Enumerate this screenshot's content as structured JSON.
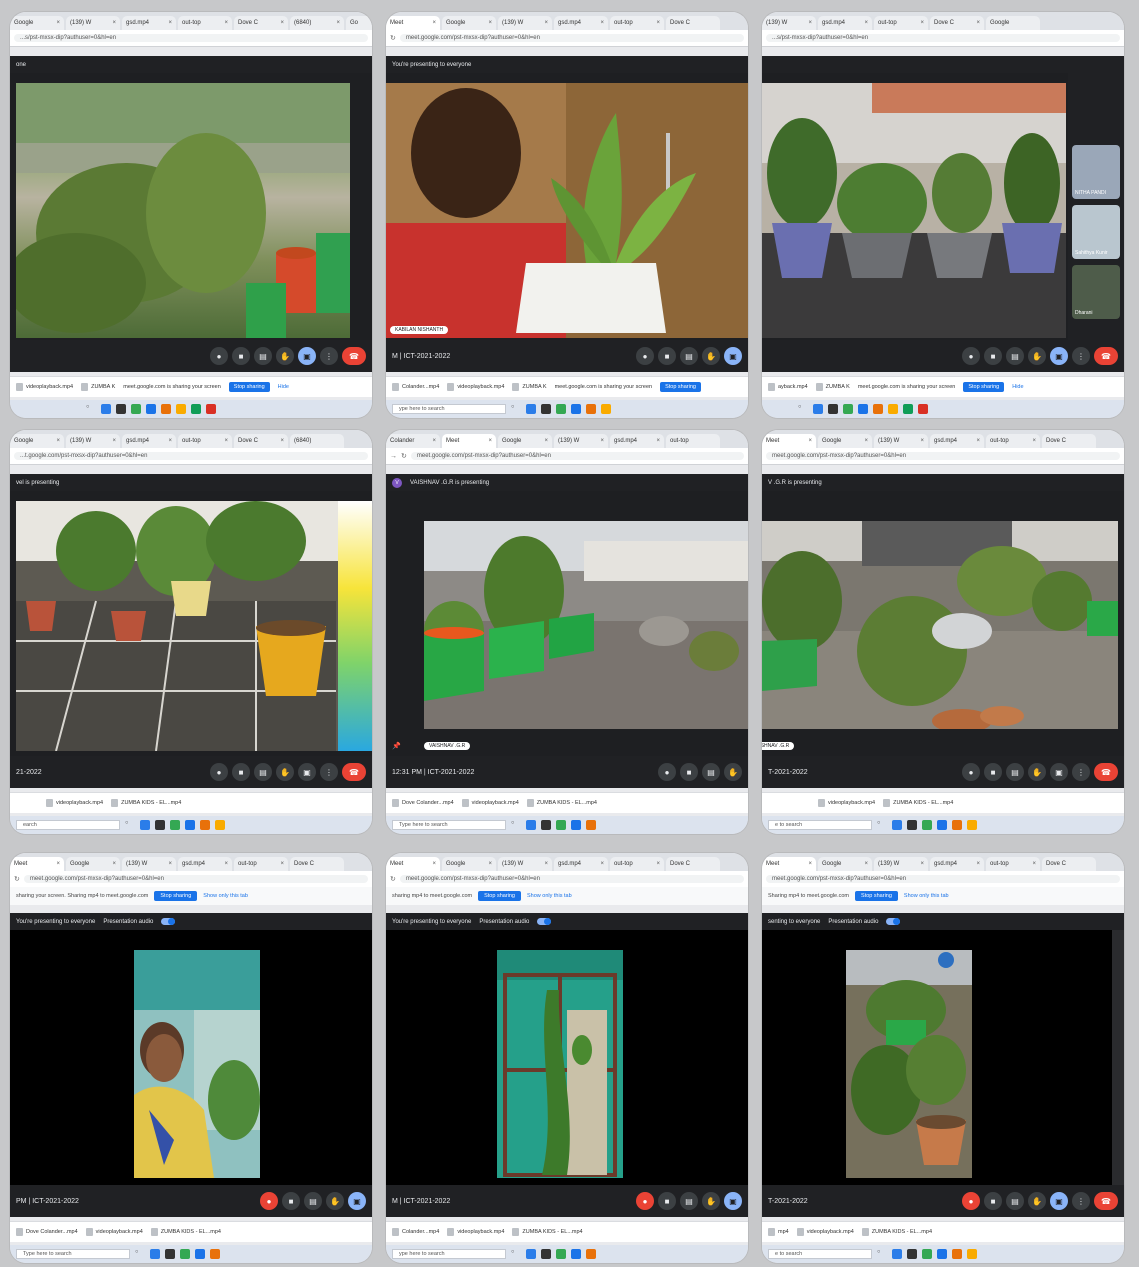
{
  "tiles": [
    {
      "tabs": [
        "Google",
        "(139) W",
        "gsd.mp4",
        "out-top",
        "Dove C",
        "(6840)",
        "Go"
      ],
      "url": "...s/pst-mxsx-dip?authuser=0&hl=en",
      "presenting_text": "one",
      "meeting_info": "",
      "name_chip": "",
      "downloads": [
        "videoplayback.mp4",
        "ZUMBA K",
        "meet.google.com is sharing your screen"
      ],
      "stop_sharing": "Stop sharing",
      "hide": "Hide",
      "search": ""
    },
    {
      "tabs": [
        "Meet",
        "Google",
        "(139) W",
        "gsd.mp4",
        "out-top",
        "Dove C"
      ],
      "url": "meet.google.com/pst-mxsx-dip?authuser=0&hl=en",
      "presenting_text": "You're presenting to everyone",
      "meeting_info": "M  |  ICT-2021-2022",
      "name_chip": "KABILAN NISHANTH",
      "downloads": [
        "Colander...mp4",
        "videoplayback.mp4",
        "ZUMBA K",
        "meet.google.com is sharing your screen"
      ],
      "stop_sharing": "Stop sharing",
      "hide": "",
      "search": "ype here to search"
    },
    {
      "tabs": [
        "(139) W",
        "gsd.mp4",
        "out-top",
        "Dove C",
        "Google"
      ],
      "url": "...s/pst-mxsx-dip?authuser=0&hl=en",
      "presenting_text": "",
      "meeting_info": "",
      "name_chip": "",
      "side_names": [
        "NITHA PANDI",
        "Sahithya Kunir",
        "Dharani"
      ],
      "downloads": [
        "ayback.mp4",
        "ZUMBA K",
        "meet.google.com is sharing your screen"
      ],
      "stop_sharing": "Stop sharing",
      "hide": "Hide",
      "search": ""
    },
    {
      "tabs": [
        "Google",
        "(139) W",
        "gsd.mp4",
        "out-top",
        "Dove C",
        "(6840)"
      ],
      "url": "...t.google.com/pst-mxsx-dip?authuser=0&hl=en",
      "presenting_text": "vel is presenting",
      "meeting_info": "21-2022",
      "name_chip": "",
      "downloads": [
        "videoplayback.mp4",
        "ZUMBA KIDS - EL...mp4"
      ],
      "search": "earch"
    },
    {
      "tabs": [
        "Colander",
        "Meet",
        "Google",
        "(139) W",
        "gsd.mp4",
        "out-top"
      ],
      "url": "meet.google.com/pst-mxsx-dip?authuser=0&hl=en",
      "presenting_text": "VAISHNAV .G.R is presenting",
      "meeting_info": "12:31 PM  |  ICT-2021-2022",
      "name_chip": "VAISHNAV .G.R",
      "downloads": [
        "Dove Colander...mp4",
        "videoplayback.mp4",
        "ZUMBA KIDS - EL...mp4"
      ],
      "search": "Type here to search"
    },
    {
      "tabs": [
        "Meet",
        "Google",
        "(139) W",
        "gsd.mp4",
        "out-top",
        "Dove C"
      ],
      "url": "meet.google.com/pst-mxsx-dip?authuser=0&hl=en",
      "presenting_text": "V .G.R is presenting",
      "meeting_info": "T-2021-2022",
      "name_chip": "VAISHNAV .G.R",
      "downloads": [
        "videoplayback.mp4",
        "ZUMBA KIDS - EL...mp4"
      ],
      "search": "e to search"
    },
    {
      "tabs": [
        "Meet",
        "Google",
        "(139) W",
        "gsd.mp4",
        "out-top",
        "Dove C"
      ],
      "url": "meet.google.com/pst-mxsx-dip?authuser=0&hl=en",
      "share_text": "sharing your screen. Sharing mp4 to meet.google.com",
      "stop_sharing": "Stop sharing",
      "hide": "Show only this tab",
      "presenting_text": "You're presenting to everyone",
      "presentation_audio": "Presentation audio",
      "meeting_info": "PM  |  ICT-2021-2022",
      "downloads": [
        "Dove Colander...mp4",
        "videoplayback.mp4",
        "ZUMBA KIDS - EL...mp4"
      ],
      "search": "Type here to search"
    },
    {
      "tabs": [
        "Meet",
        "Google",
        "(139) W",
        "gsd.mp4",
        "out-top",
        "Dove C"
      ],
      "url": "meet.google.com/pst-mxsx-dip?authuser=0&hl=en",
      "share_text": "sharing mp4 to meet.google.com",
      "stop_sharing": "Stop sharing",
      "hide": "Show only this tab",
      "presenting_text": "You're presenting to everyone",
      "presentation_audio": "Presentation audio",
      "meeting_info": "M  |  ICT-2021-2022",
      "downloads": [
        "Colander...mp4",
        "videoplayback.mp4",
        "ZUMBA KIDS - EL...mp4"
      ],
      "search": "ype here to search"
    },
    {
      "tabs": [
        "Meet",
        "Google",
        "(139) W",
        "gsd.mp4",
        "out-top",
        "Dove C"
      ],
      "url": "meet.google.com/pst-mxsx-dip?authuser=0&hl=en",
      "share_text": "Sharing mp4 to meet.google.com",
      "stop_sharing": "Stop sharing",
      "hide": "Show only this tab",
      "presenting_text": "senting to everyone",
      "presentation_audio": "Presentation audio",
      "meeting_info": "T-2021-2022",
      "downloads": [
        "mp4",
        "videoplayback.mp4",
        "ZUMBA KIDS - EL...mp4"
      ],
      "search": "e to search"
    }
  ],
  "colors": {
    "meet_dark": "#202124",
    "accent_blue": "#8ab4f8",
    "stop_red": "#ea4335",
    "chrome_blue": "#1a73e8"
  },
  "icons": [
    "mic-icon",
    "camera-icon",
    "captions-icon",
    "raise-hand-icon",
    "present-icon",
    "more-icon",
    "end-call-icon"
  ]
}
